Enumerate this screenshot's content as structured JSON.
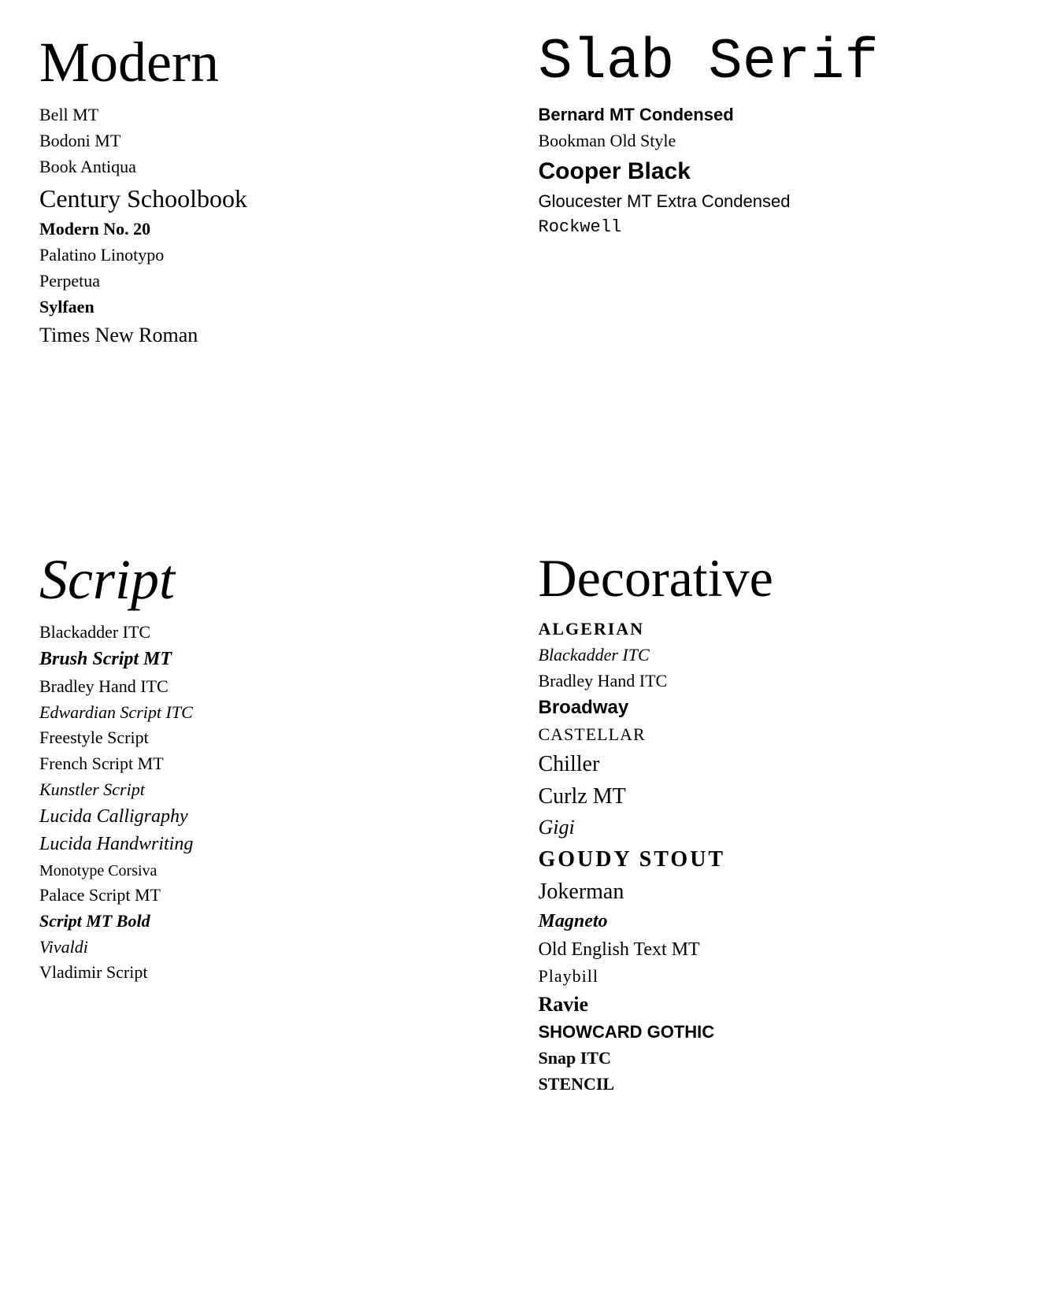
{
  "sections": {
    "modern": {
      "title": "Modern",
      "fonts": [
        {
          "name": "Bell MT",
          "class": "bell-mt"
        },
        {
          "name": "Bodoni MT",
          "class": "bodoni-mt"
        },
        {
          "name": "Book Antiqua",
          "class": "book-antiqua"
        },
        {
          "name": "Century Schoolbook",
          "class": "century-schoolbook"
        },
        {
          "name": "Modern No. 20",
          "class": "modern-no20"
        },
        {
          "name": "Palatino Linotypo",
          "class": "palatino"
        },
        {
          "name": "Perpetua",
          "class": "perpetua"
        },
        {
          "name": "Sylfaen",
          "class": "sylfaen"
        },
        {
          "name": "Times New Roman",
          "class": "times-new-roman"
        }
      ]
    },
    "slab_serif": {
      "title": "Slab Serif",
      "fonts": [
        {
          "name": "Bernard MT Condensed",
          "class": "bernard-mt"
        },
        {
          "name": "Bookman Old Style",
          "class": "bookman"
        },
        {
          "name": "Cooper Black",
          "class": "cooper-black"
        },
        {
          "name": "Gloucester MT Extra Condensed",
          "class": "gloucester"
        },
        {
          "name": "Rockwell",
          "class": "rockwell"
        }
      ]
    },
    "script": {
      "title": "Script",
      "fonts": [
        {
          "name": "Blackadder ITC",
          "class": "blackadder"
        },
        {
          "name": "Brush Script MT",
          "class": "brush-script"
        },
        {
          "name": "Bradley Hand ITC",
          "class": "bradley-hand"
        },
        {
          "name": "Edwardian Script ITC",
          "class": "edwardian"
        },
        {
          "name": "Freestyle Script",
          "class": "freestyle"
        },
        {
          "name": "French Script MT",
          "class": "french-script"
        },
        {
          "name": "Kunstler Script",
          "class": "kunstler"
        },
        {
          "name": "Lucida Calligraphy",
          "class": "lucida-calligraphy"
        },
        {
          "name": "Lucida Handwriting",
          "class": "lucida-handwriting"
        },
        {
          "name": "Monotype Corsiva",
          "class": "monotype-corsiva"
        },
        {
          "name": "Palace Script MT",
          "class": "palace-script"
        },
        {
          "name": "Script MT Bold",
          "class": "script-mt-bold"
        },
        {
          "name": "Vivaldi",
          "class": "vivaldi"
        },
        {
          "name": "Vladimir Script",
          "class": "vladimir"
        }
      ]
    },
    "decorative": {
      "title": "Decorative",
      "fonts": [
        {
          "name": "ALGERIAN",
          "class": "algerian"
        },
        {
          "name": "Blackadder ITC",
          "class": "dec-blackadder"
        },
        {
          "name": "Bradley Hand ITC",
          "class": "dec-bradley"
        },
        {
          "name": "Broadway",
          "class": "broadway"
        },
        {
          "name": "CASTELLAR",
          "class": "castellar"
        },
        {
          "name": "Chiller",
          "class": "chiller"
        },
        {
          "name": "Curlz MT",
          "class": "curlz"
        },
        {
          "name": "Gigi",
          "class": "gigi"
        },
        {
          "name": "GOUDY STOUT",
          "class": "goudy-stout"
        },
        {
          "name": "Jokerman",
          "class": "jokerman"
        },
        {
          "name": "Magneto",
          "class": "magneto"
        },
        {
          "name": "Old English Text MT",
          "class": "old-english"
        },
        {
          "name": "Playbill",
          "class": "playbill"
        },
        {
          "name": "Ravie",
          "class": "ravie"
        },
        {
          "name": "SHOWCARD GOTHIC",
          "class": "showcard"
        },
        {
          "name": "Snap ITC",
          "class": "snap-itc"
        },
        {
          "name": "STENCIL",
          "class": "stencil"
        }
      ]
    }
  }
}
